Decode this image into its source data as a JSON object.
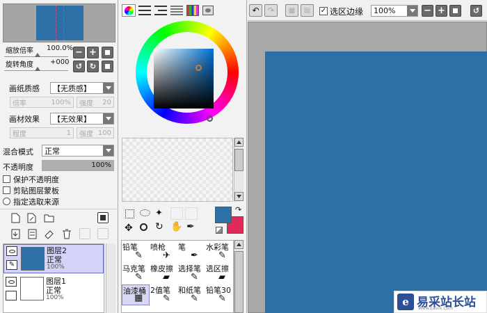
{
  "navigator": {
    "zoom_label": "缩放倍率",
    "zoom_value": "100.0%",
    "rotate_label": "旋转角度",
    "rotate_value": "+000"
  },
  "paper": {
    "texture_label": "画纸质感",
    "texture_value": "【无质感】",
    "scale_label": "倍率",
    "scale_value": "100%",
    "strength_label": "强度",
    "strength_value": "20"
  },
  "material": {
    "effect_label": "画材效果",
    "effect_value": "【无效果】",
    "degree_label": "程度",
    "degree_value": "1",
    "strength_label": "强度",
    "strength_value": "100"
  },
  "layer_props": {
    "blend_label": "混合模式",
    "blend_value": "正常",
    "opacity_label": "不透明度",
    "opacity_value": "100%",
    "opacity_fraction": 1.0,
    "preserve_opacity": "保护不透明度",
    "clipping_mask": "剪贴图层蒙板",
    "selection_source": "指定选取来源"
  },
  "layers": [
    {
      "name": "图层2",
      "mode": "正常",
      "opacity": "100%",
      "color": "#2d70a8",
      "selected": true
    },
    {
      "name": "图层1",
      "mode": "正常",
      "opacity": "100%",
      "color": "#ffffff",
      "selected": false
    }
  ],
  "color": {
    "foreground": "#2d70a8",
    "background": "#e02a5a"
  },
  "tools": [
    {
      "label": "铅笔"
    },
    {
      "label": "喷枪"
    },
    {
      "label": "笔"
    },
    {
      "label": "水彩笔"
    },
    {
      "label": "马克笔"
    },
    {
      "label": "橡皮擦"
    },
    {
      "label": "选择笔"
    },
    {
      "label": "选区擦"
    },
    {
      "label": "油漆桶"
    },
    {
      "label": "2值笔"
    },
    {
      "label": "和纸笔"
    },
    {
      "label": "铅笔30"
    }
  ],
  "toolbar": {
    "selection_edge_label": "选区边缘",
    "selection_edge_checked": true,
    "zoom_value": "100%"
  },
  "canvas": {
    "fill": "#2d70a8",
    "backdrop": "#a8a8a8"
  },
  "watermark": {
    "site_name": "易采站长站",
    "url": "Www.Easck.Com"
  }
}
